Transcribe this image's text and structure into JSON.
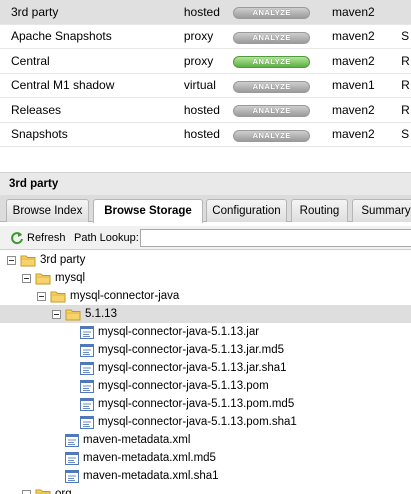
{
  "repositories": [
    {
      "name": "3rd party",
      "type": "hosted",
      "action": "ANALYZE",
      "format": "maven2",
      "extra": "",
      "selected": true,
      "action_active": false
    },
    {
      "name": "Apache Snapshots",
      "type": "proxy",
      "action": "ANALYZE",
      "format": "maven2",
      "extra": "S",
      "selected": false,
      "action_active": false
    },
    {
      "name": "Central",
      "type": "proxy",
      "action": "ANALYZE",
      "format": "maven2",
      "extra": "R",
      "selected": false,
      "action_active": true
    },
    {
      "name": "Central M1 shadow",
      "type": "virtual",
      "action": "ANALYZE",
      "format": "maven1",
      "extra": "R",
      "selected": false,
      "action_active": false
    },
    {
      "name": "Releases",
      "type": "hosted",
      "action": "ANALYZE",
      "format": "maven2",
      "extra": "R",
      "selected": false,
      "action_active": false
    },
    {
      "name": "Snapshots",
      "type": "hosted",
      "action": "ANALYZE",
      "format": "maven2",
      "extra": "S",
      "selected": false,
      "action_active": false
    }
  ],
  "panel": {
    "title": "3rd party"
  },
  "tabs": [
    {
      "label": "Browse Index",
      "active": false
    },
    {
      "label": "Browse Storage",
      "active": true
    },
    {
      "label": "Configuration",
      "active": false
    },
    {
      "label": "Routing",
      "active": false
    },
    {
      "label": "Summary",
      "active": false
    }
  ],
  "toolbar": {
    "refresh_label": "Refresh",
    "lookup_label": "Path Lookup:",
    "lookup_value": ""
  },
  "tree": [
    {
      "label": "3rd party",
      "kind": "folder",
      "depth": 0,
      "expanded": true
    },
    {
      "label": "mysql",
      "kind": "folder",
      "depth": 1,
      "expanded": true
    },
    {
      "label": "mysql-connector-java",
      "kind": "folder",
      "depth": 2,
      "expanded": true
    },
    {
      "label": "5.1.13",
      "kind": "folder",
      "depth": 3,
      "expanded": true,
      "selected": true
    },
    {
      "label": "mysql-connector-java-5.1.13.jar",
      "kind": "file",
      "depth": 4,
      "highlight": true
    },
    {
      "label": "mysql-connector-java-5.1.13.jar.md5",
      "kind": "file",
      "depth": 4
    },
    {
      "label": "mysql-connector-java-5.1.13.jar.sha1",
      "kind": "file",
      "depth": 4
    },
    {
      "label": "mysql-connector-java-5.1.13.pom",
      "kind": "file",
      "depth": 4
    },
    {
      "label": "mysql-connector-java-5.1.13.pom.md5",
      "kind": "file",
      "depth": 4
    },
    {
      "label": "mysql-connector-java-5.1.13.pom.sha1",
      "kind": "file",
      "depth": 4
    },
    {
      "label": "maven-metadata.xml",
      "kind": "file",
      "depth": 3
    },
    {
      "label": "maven-metadata.xml.md5",
      "kind": "file",
      "depth": 3
    },
    {
      "label": "maven-metadata.xml.sha1",
      "kind": "file",
      "depth": 3
    },
    {
      "label": "org",
      "kind": "folder",
      "depth": 1,
      "expanded": false
    }
  ],
  "colors": {
    "analyze_active": "#5cb043",
    "analyze_inactive": "#9b9b9b",
    "selection": "#e0e0e0",
    "folder": "#f2c94c"
  }
}
